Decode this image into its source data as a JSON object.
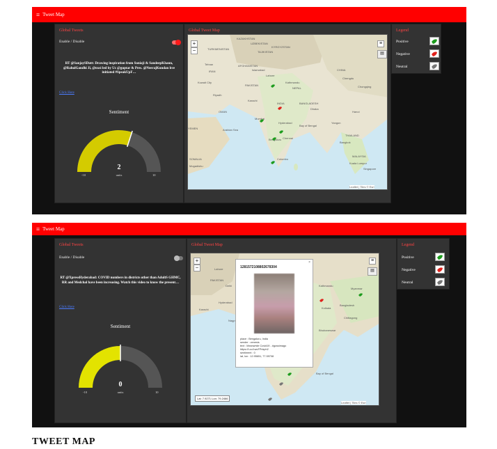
{
  "app": {
    "title": "Tweet Map"
  },
  "caption": "TWEET MAP",
  "screens": [
    {
      "topbar_title": "Tweet Map",
      "tweets_panel": {
        "title": "Global Tweets",
        "toggle_label": "Enable / Disable",
        "toggle_on": true,
        "tweet_text": "RT @SanjaySDutt: Drawing inspiration from Soniaji & SandeepKhann, @RahulGandhi Ji, @nxsi led by Uc @guptar & Pres. @NeerajKundan hve initiated #SpeakUpF…",
        "link_text": "Click Here",
        "sentiment_title": "Sentiment",
        "gauge_value": "2",
        "gauge_value_num": 2,
        "gauge_unit": "units",
        "gauge_min": "-10",
        "gauge_max": "10"
      },
      "map_panel": {
        "title": "Global Tweet Map",
        "attribution": "Leaflet | Tiles © Esri",
        "labels": [
          "KAZAKHSTAN",
          "UZBEKISTAN",
          "TURKMENISTAN",
          "KYRGYZSTAN",
          "TAJIKISTAN",
          "Tehran",
          "AFGHANISTAN",
          "IRAN",
          "Islamabad",
          "CHINA",
          "Kuwait City",
          "PAKISTAN",
          "Lahore",
          "Kathmandu",
          "Chengdu",
          "Riyadh",
          "NEPAL",
          "INDIA",
          "Chongqing",
          "Karachi",
          "BANGLADESH",
          "OMAN",
          "Dhaka",
          "Hanoi",
          "YEMEN",
          "Mumbai",
          "Hyderabad",
          "Yangon",
          "Bay of Bengal",
          "Arabian Sea",
          "Bengaluru",
          "Chennai",
          "THAILAND",
          "Bangkok",
          "Colombo",
          "MALAYSIA",
          "Kuala Lumpur",
          "Singapore",
          "SOMALIA",
          "Mogadishu"
        ]
      },
      "legend": {
        "title": "Legend",
        "items": [
          {
            "label": "Positive",
            "color": "#1e9c1e"
          },
          {
            "label": "Negative",
            "color": "#e0211b"
          },
          {
            "label": "Neutral",
            "color": "#777777"
          }
        ]
      }
    },
    {
      "topbar_title": "Tweet Map",
      "tweets_panel": {
        "title": "Global Tweets",
        "toggle_label": "Enable / Disable",
        "toggle_on": false,
        "tweet_text": "RT @XpressHyderabad: COVID numbers in districts other than AdultS GHMC, RR and Medchal have been increasing. Watch this video to know the present…",
        "link_text": "Click Here",
        "sentiment_title": "Sentiment",
        "gauge_value": "0",
        "gauge_value_num": 0,
        "gauge_unit": "units",
        "gauge_min": "-10",
        "gauge_max": "10"
      },
      "map_panel": {
        "title": "Global Tweet Map",
        "attribution": "Leaflet | Tiles © Esri",
        "coords": "Lat: 7.9271 Lon: 79.2466",
        "popup": {
          "title": "1281572108802678304",
          "place": "place : Bengaluru, India",
          "sender": "sender : zenesis",
          "text": "text : Meanwhile Covid19 - #gossimago",
          "url": "https://t.co/LwuFPnkph2",
          "sentiment": "sentiment : 0",
          "latlon": "lat, lon : 12.95651, 77.59708"
        },
        "labels": [
          "Lahore",
          "PAKISTAN",
          "Delhi",
          "Hyderabad",
          "Karachi",
          "Kathmandu",
          "Bangladesh",
          "Kolkata",
          "Nagpur",
          "INDIA",
          "Bay of Bengal",
          "Bhubaneswar",
          "Chittagong",
          "Myanmar"
        ]
      },
      "legend": {
        "title": "Legend",
        "items": [
          {
            "label": "Positive",
            "color": "#1e9c1e"
          },
          {
            "label": "Negative",
            "color": "#e0211b"
          },
          {
            "label": "Neutral",
            "color": "#777777"
          }
        ]
      }
    }
  ],
  "icons": {
    "marker": "twitter-bird-icon",
    "zoom_in": "+",
    "zoom_out": "−",
    "layers": "layers-icon",
    "menu": "hamburger-icon"
  }
}
